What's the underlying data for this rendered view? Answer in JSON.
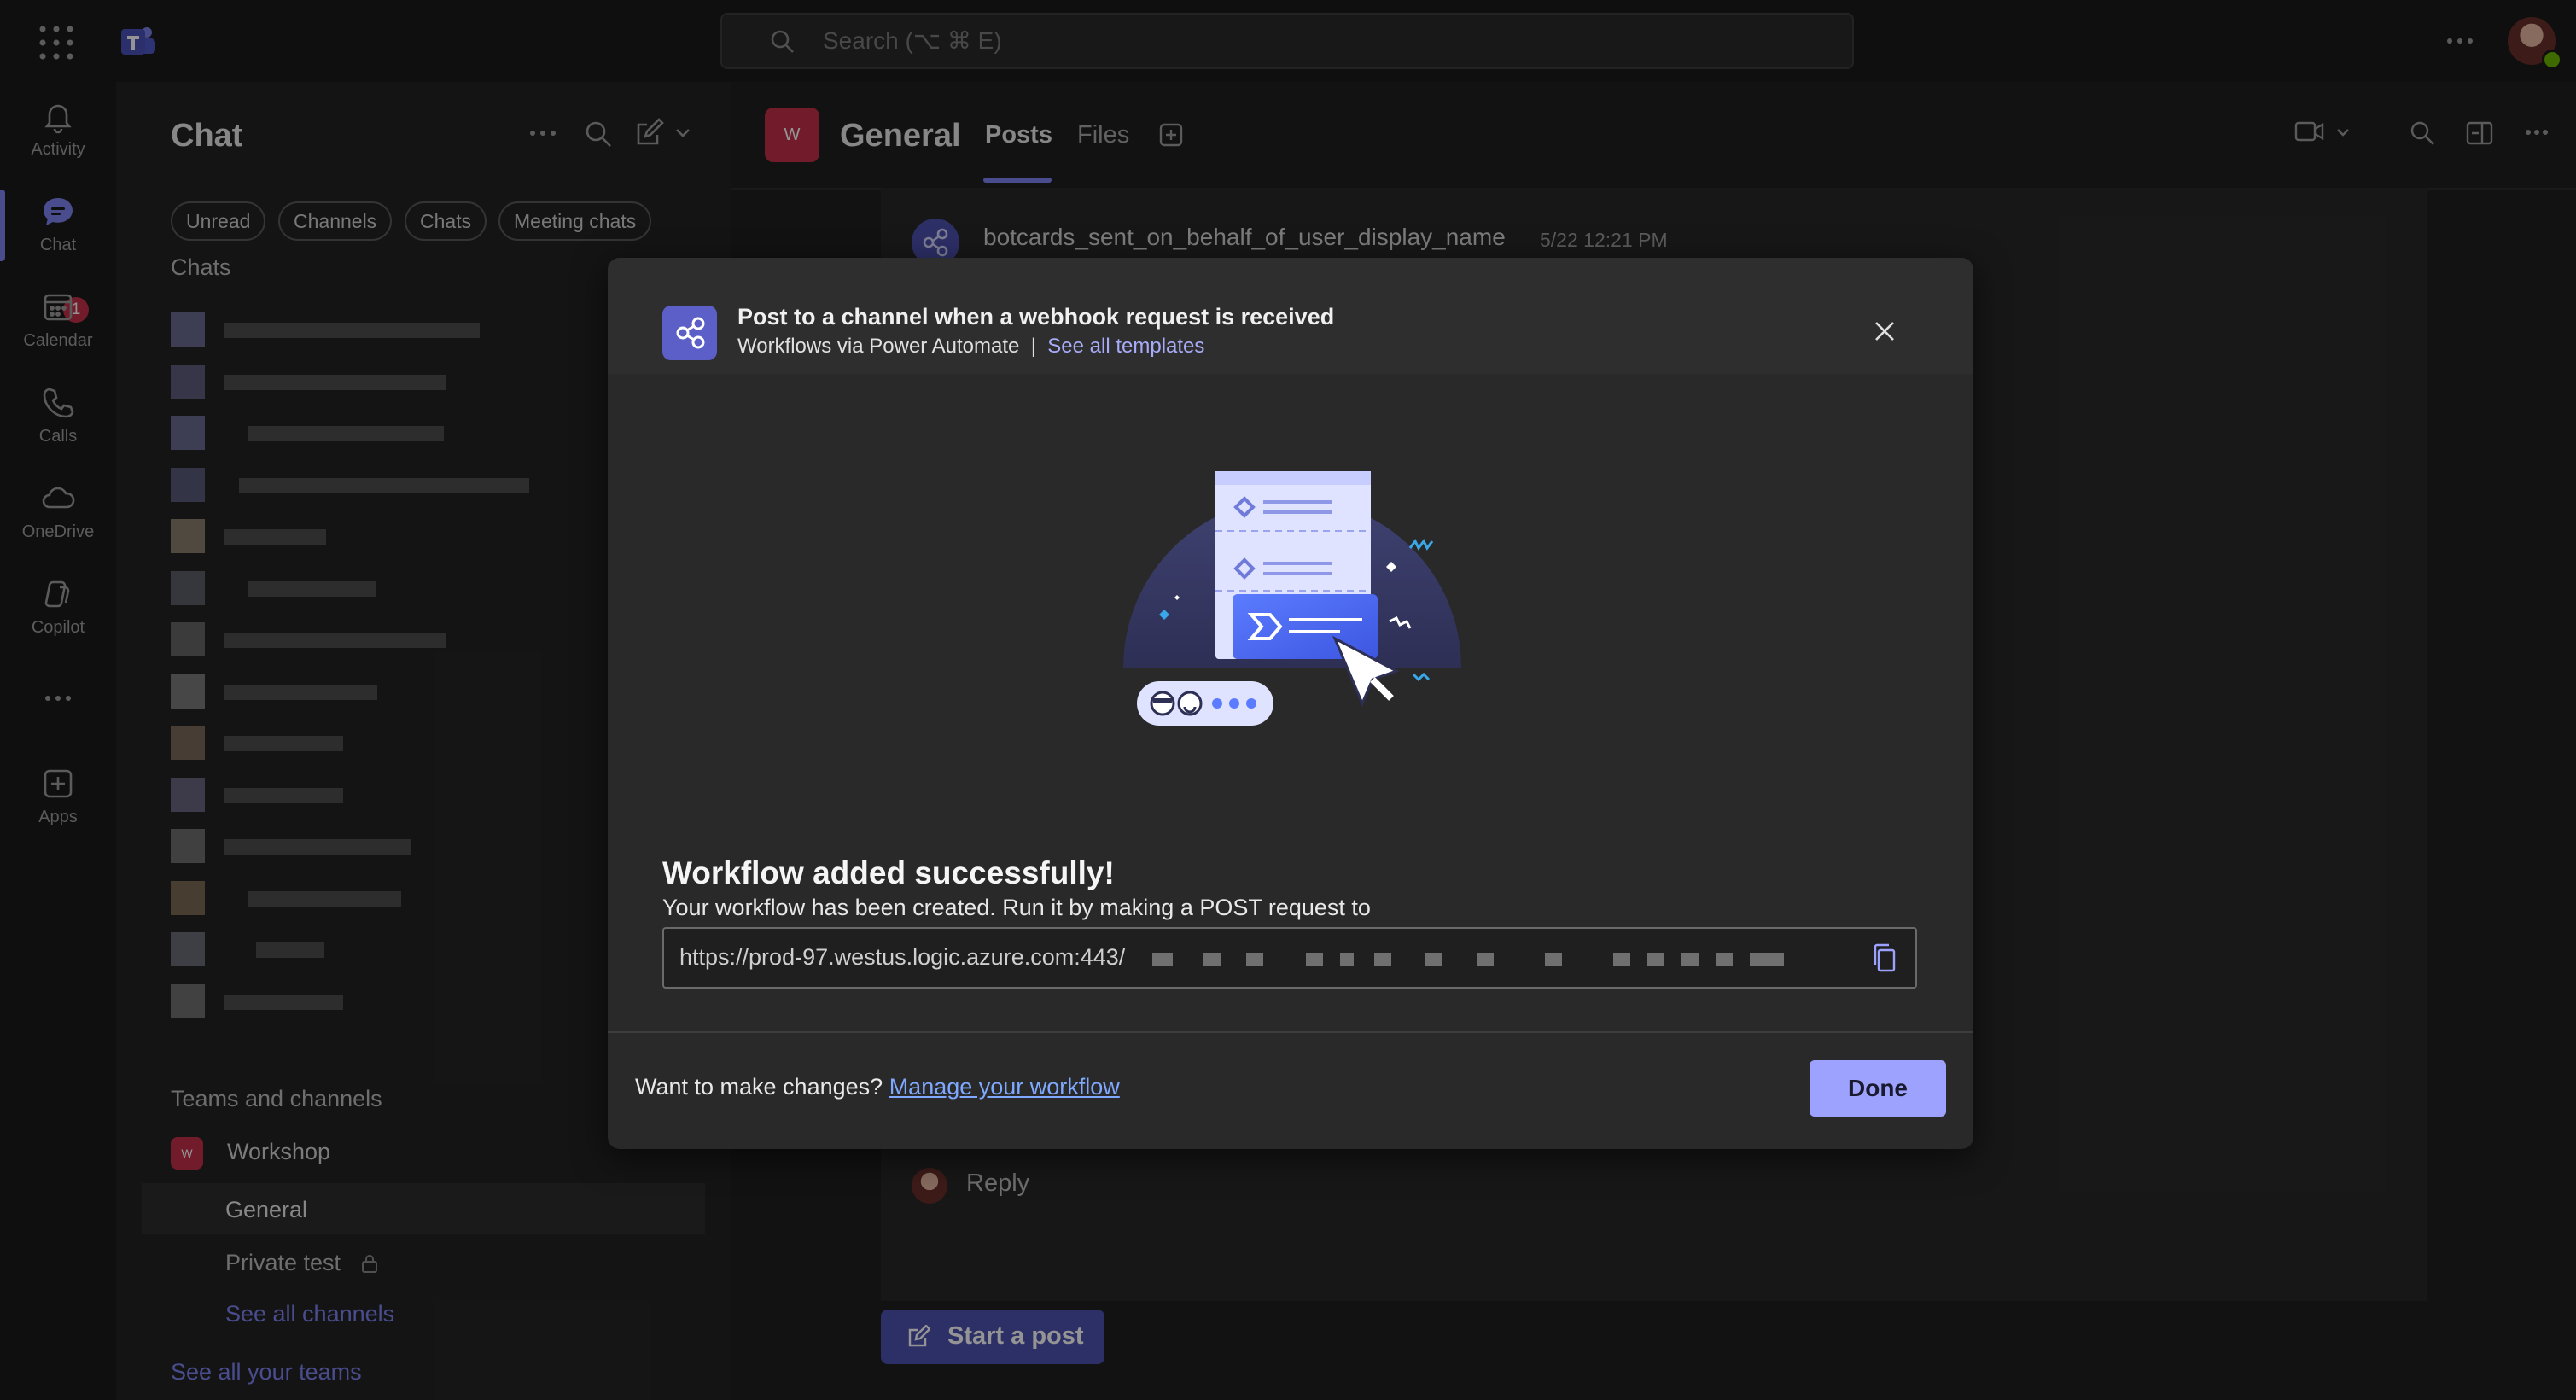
{
  "topbar": {
    "search_placeholder": "Search (⌥ ⌘ E)"
  },
  "rail": {
    "items": [
      {
        "label": "Activity",
        "icon": "bell-icon"
      },
      {
        "label": "Chat",
        "icon": "chat-icon",
        "badge": "1"
      },
      {
        "label": "Calendar",
        "icon": "calendar-icon"
      },
      {
        "label": "Calls",
        "icon": "phone-icon"
      },
      {
        "label": "OneDrive",
        "icon": "cloud-icon"
      },
      {
        "label": "Copilot",
        "icon": "copilot-icon"
      },
      {
        "label": "",
        "icon": "more-icon"
      },
      {
        "label": "Apps",
        "icon": "add-apps-icon"
      }
    ]
  },
  "chatpane": {
    "title": "Chat",
    "filters": [
      "Unread",
      "Channels",
      "Chats",
      "Meeting chats"
    ],
    "chats_heading": "Chats",
    "teams_heading": "Teams and channels",
    "team": {
      "avatar": "W",
      "name": "Workshop"
    },
    "channels": [
      "General",
      "Private test"
    ],
    "see_all_channels": "See all channels",
    "see_all_teams": "See all your teams"
  },
  "channel": {
    "avatar": "W",
    "name": "General",
    "tabs": [
      "Posts",
      "Files"
    ],
    "post": {
      "author": "botcards_sent_on_behalf_of_user_display_name",
      "time": "5/22 12:21 PM"
    },
    "reply_label": "Reply",
    "start_post_label": "Start a post"
  },
  "dialog": {
    "title": "Post to a channel when a webhook request is received",
    "source": "Workflows via Power Automate",
    "separator": "|",
    "templates_link": "See all templates",
    "success_title": "Workflow added successfully!",
    "success_desc": "Your workflow has been created. Run it by making a POST request to",
    "url_visible": "https://prod-97.westus.logic.azure.com:443/",
    "changes_prompt": "Want to make changes?",
    "manage_link": "Manage your workflow",
    "done_label": "Done"
  },
  "colors": {
    "accent": "#7f85f5",
    "brand_purple": "#5b5fc7",
    "team_red": "#c4314b",
    "done_button": "#9ea2ff",
    "link_blue": "#7fa8ff"
  }
}
